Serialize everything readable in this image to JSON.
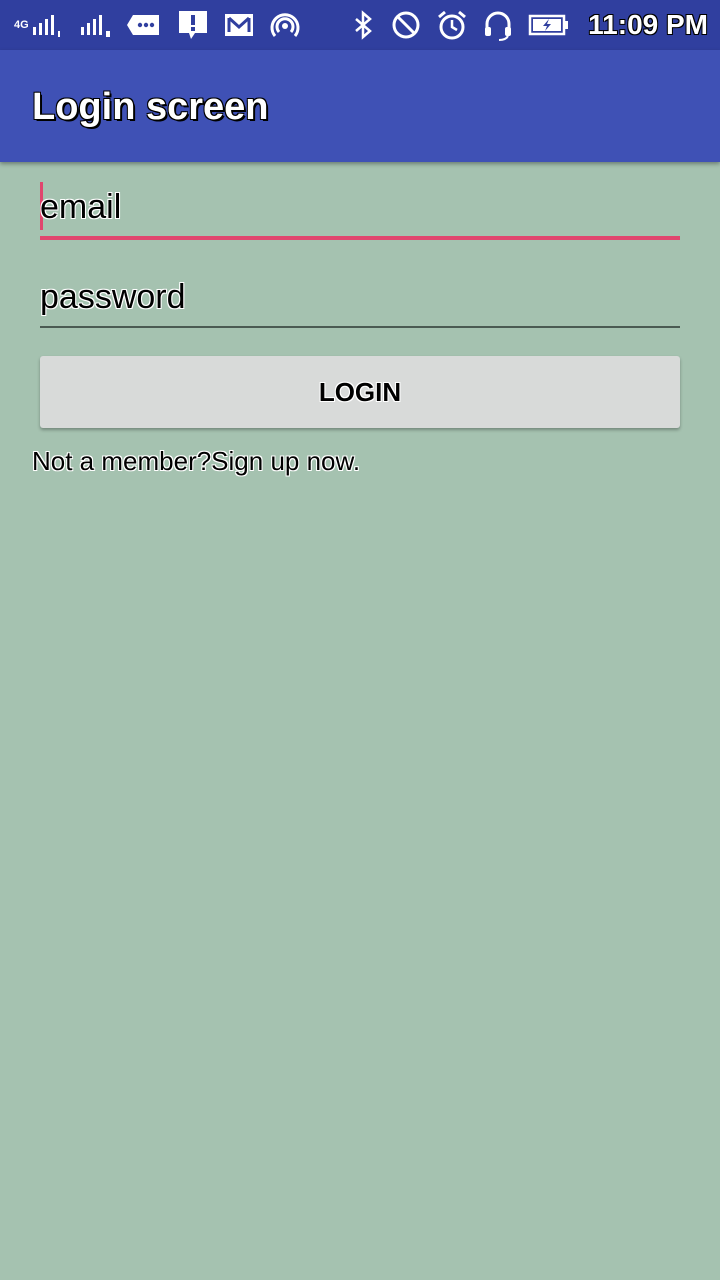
{
  "status_bar": {
    "network_label": "4G",
    "time": "11:09 PM",
    "icons": [
      "signal-sim1-icon",
      "signal-sim2-icon",
      "message-icon",
      "alert-icon",
      "gmail-icon",
      "hotspot-icon",
      "bluetooth-icon",
      "do-not-disturb-icon",
      "alarm-icon",
      "headset-icon",
      "battery-charging-icon"
    ]
  },
  "app_bar": {
    "title": "Login screen"
  },
  "form": {
    "email_placeholder": "email",
    "password_placeholder": "password",
    "login_label": "LOGIN",
    "signup_text": "Not a member?Sign up now."
  },
  "colors": {
    "status_bar": "#303f9f",
    "app_bar": "#3f51b5",
    "background": "#a5c2b0",
    "accent": "#e0466e",
    "button": "#d8dad9"
  }
}
